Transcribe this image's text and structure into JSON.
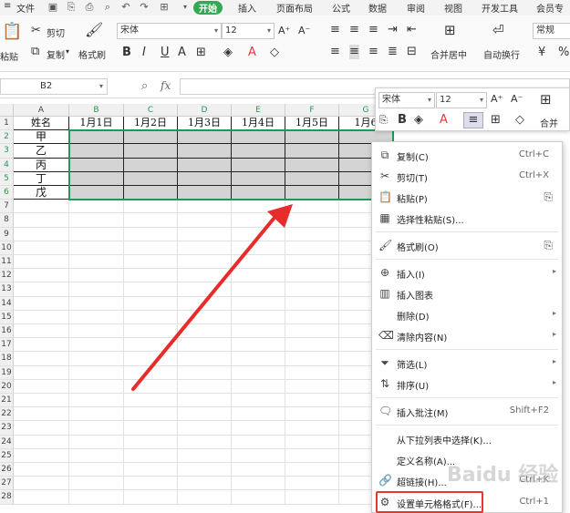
{
  "menubar": {
    "items": [
      "文件",
      "开始",
      "插入",
      "页面布局",
      "公式",
      "数据",
      "审阅",
      "视图",
      "开发工具",
      "会员专享"
    ]
  },
  "ribbon": {
    "paste": "粘贴",
    "cut": "剪切",
    "copy": "复制",
    "format_painter": "格式刷",
    "font_name": "宋体",
    "font_size": "12",
    "merge_center": "合并居中",
    "wrap_text": "自动换行",
    "number_format": "常规",
    "bold": "B",
    "italic": "I",
    "underline": "U",
    "font_color_letter": "A",
    "currency": "¥",
    "percent": "%"
  },
  "formula_bar": {
    "name_box": "B2",
    "fx": "fx"
  },
  "sheet": {
    "columns": [
      "A",
      "B",
      "C",
      "D",
      "E",
      "F",
      "G"
    ],
    "rows": [
      "1",
      "2",
      "3",
      "4",
      "5",
      "6",
      "7",
      "8",
      "9",
      "10",
      "11",
      "12",
      "13",
      "14",
      "15",
      "16",
      "17",
      "18",
      "19",
      "20",
      "21",
      "22",
      "23",
      "24",
      "25",
      "26",
      "27",
      "28"
    ],
    "header_cells": [
      "姓名",
      "1月1日",
      "1月2日",
      "1月3日",
      "1月4日",
      "1月5日",
      "1月6"
    ],
    "names": [
      "甲",
      "乙",
      "丙",
      "丁",
      "戊"
    ]
  },
  "mini_toolbar": {
    "font_name": "宋体",
    "font_size": "12",
    "bold": "B",
    "merge": "合并"
  },
  "context_menu": {
    "items": [
      {
        "label": "复制(C)",
        "shortcut": "Ctrl+C"
      },
      {
        "label": "剪切(T)",
        "shortcut": "Ctrl+X"
      },
      {
        "label": "粘贴(P)",
        "shortcut": ""
      },
      {
        "label": "选择性粘贴(S)...",
        "shortcut": ""
      },
      {
        "label": "格式刷(O)",
        "shortcut": ""
      },
      {
        "label": "插入(I)",
        "shortcut": ""
      },
      {
        "label": "插入图表",
        "shortcut": ""
      },
      {
        "label": "删除(D)",
        "shortcut": ""
      },
      {
        "label": "清除内容(N)",
        "shortcut": ""
      },
      {
        "label": "筛选(L)",
        "shortcut": ""
      },
      {
        "label": "排序(U)",
        "shortcut": ""
      },
      {
        "label": "插入批注(M)",
        "shortcut": "Shift+F2"
      },
      {
        "label": "从下拉列表中选择(K)...",
        "shortcut": ""
      },
      {
        "label": "定义名称(A)...",
        "shortcut": ""
      },
      {
        "label": "超链接(H)...",
        "shortcut": "Ctrl+K"
      },
      {
        "label": "设置单元格格式(F)...",
        "shortcut": "Ctrl+1"
      }
    ]
  },
  "colors": {
    "accent_green": "#35a853",
    "selection_green": "#1f9a55",
    "highlight_red": "#e33333",
    "arrow_red": "#e82b2b",
    "cell_gray": "#d4d4d4"
  },
  "watermark": "Baidu 经验"
}
